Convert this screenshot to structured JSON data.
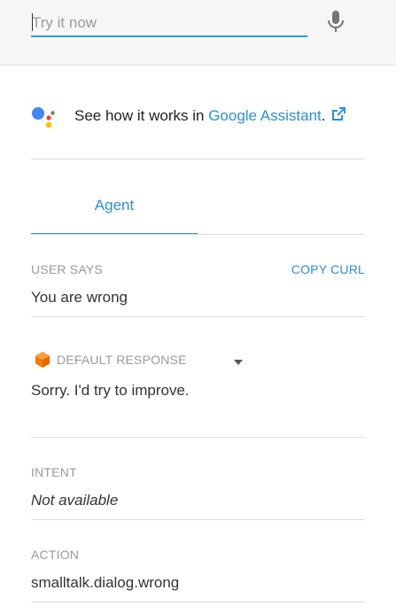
{
  "try_it": {
    "placeholder": "Try it now",
    "mic_icon": "microphone-icon"
  },
  "assistant": {
    "logo_icon": "google-assistant-logo-icon",
    "prefix": "See how it works in ",
    "link_text": "Google Assistant",
    "suffix": ".",
    "external_icon": "external-link-icon"
  },
  "tabs": [
    {
      "label": "Agent",
      "active": true
    }
  ],
  "user_says": {
    "label": "USER SAYS",
    "value": "You are wrong",
    "copy_curl": "COPY CURL"
  },
  "response": {
    "icon": "dialogflow-cube-icon",
    "label": "DEFAULT RESPONSE",
    "dropdown_icon": "caret-down-icon",
    "value": "Sorry. I'd try to improve."
  },
  "intent": {
    "label": "INTENT",
    "value": "Not available"
  },
  "action": {
    "label": "ACTION",
    "value": "smalltalk.dialog.wrong"
  },
  "colors": {
    "accent": "#2c8fd6",
    "input_underline": "#2c9be0",
    "muted_label": "#9a9a9a",
    "header_bg": "#f6f6f6",
    "response_icon": "#f57c00"
  }
}
